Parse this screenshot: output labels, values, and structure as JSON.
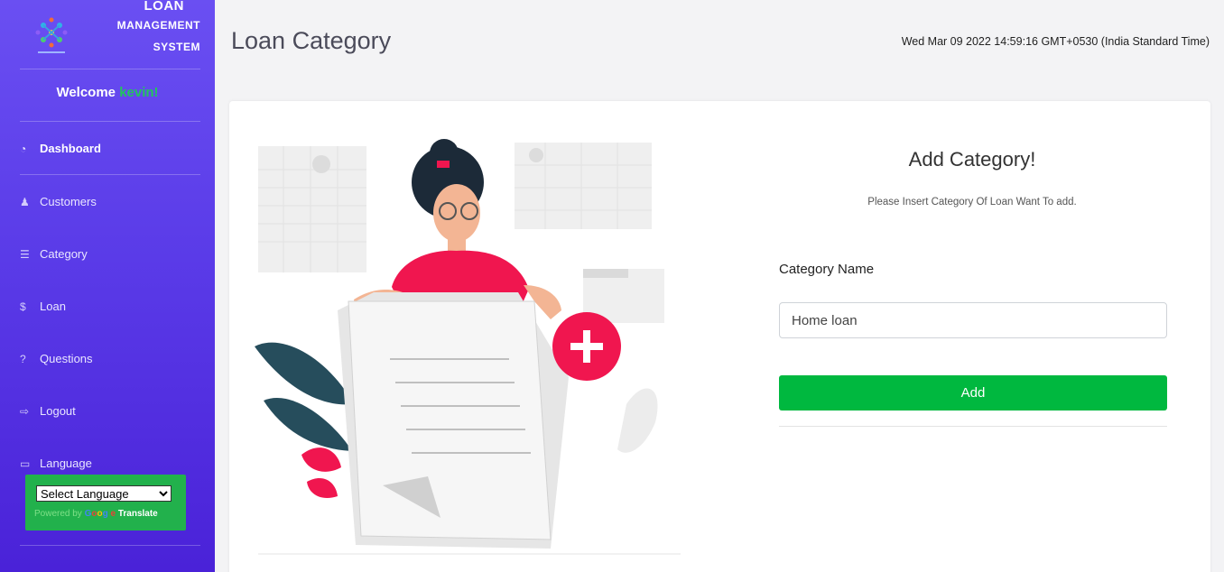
{
  "sidebar": {
    "brand": {
      "line1": "LOAN",
      "line2": "MANAGEMENT",
      "line3": "SYSTEM"
    },
    "welcome": {
      "prefix": "Welcome",
      "user": "kevin!"
    },
    "items": [
      {
        "label": "Dashboard",
        "icon": "dashboard-icon",
        "glyph": "◔"
      },
      {
        "label": "Customers",
        "icon": "user-icon",
        "glyph": "♟"
      },
      {
        "label": "Category",
        "icon": "list-icon",
        "glyph": "☰"
      },
      {
        "label": "Loan",
        "icon": "hand-money-icon",
        "glyph": "$"
      },
      {
        "label": "Questions",
        "icon": "question-icon",
        "glyph": "?"
      },
      {
        "label": "Logout",
        "icon": "logout-icon",
        "glyph": "⇨"
      },
      {
        "label": "Language",
        "icon": "language-icon",
        "glyph": "▭"
      }
    ],
    "language_select": {
      "selected": "Select Language"
    },
    "powered_by": {
      "prefix": "Powered by",
      "google": "Google",
      "translate": "Translate"
    }
  },
  "header": {
    "title": "Loan Category",
    "datetime": "Wed Mar 09 2022 14:59:16 GMT+0530 (India Standard Time)"
  },
  "form": {
    "title": "Add Category!",
    "subtitle": "Please Insert Category Of Loan Want To add.",
    "field_label": "Category Name",
    "field_value": "Home loan",
    "button_label": "Add"
  },
  "colors": {
    "sidebar_top": "#6a4ff2",
    "sidebar_bottom": "#4a22d8",
    "accent_green": "#00b83f",
    "welcome_name": "#22c55e",
    "illustration_pink": "#f0164f"
  }
}
